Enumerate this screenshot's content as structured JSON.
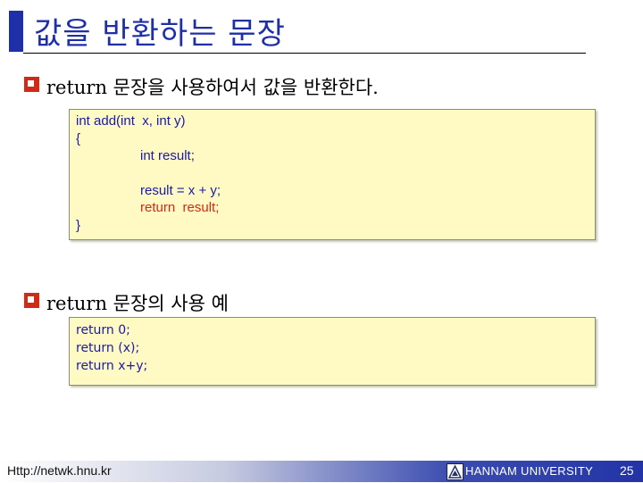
{
  "slide": {
    "title": "값을 반환하는 문장",
    "bullets": [
      "return 문장을 사용하여서 값을 반환한다.",
      "return 문장의 사용 예"
    ],
    "code1": [
      "int add(int  x, int y)",
      "{",
      "int result;",
      "result = x + y;",
      "return  result;",
      "}"
    ],
    "code2": [
      "return 0;",
      "return (x);",
      "return x+y;"
    ]
  },
  "footer": {
    "url": "Http://netwk.hnu.kr",
    "university": "HANNAM  UNIVERSITY",
    "page": "25"
  },
  "colors": {
    "title": "#1f2fa8",
    "bullet": "#d12a16",
    "code_text": "#1a1aa6",
    "code_highlight": "#d12a16",
    "code_background": "#fff9c4"
  },
  "icons": {
    "bullet": "checkbox-bullet-icon",
    "footer_logo": "university-logo-icon"
  }
}
